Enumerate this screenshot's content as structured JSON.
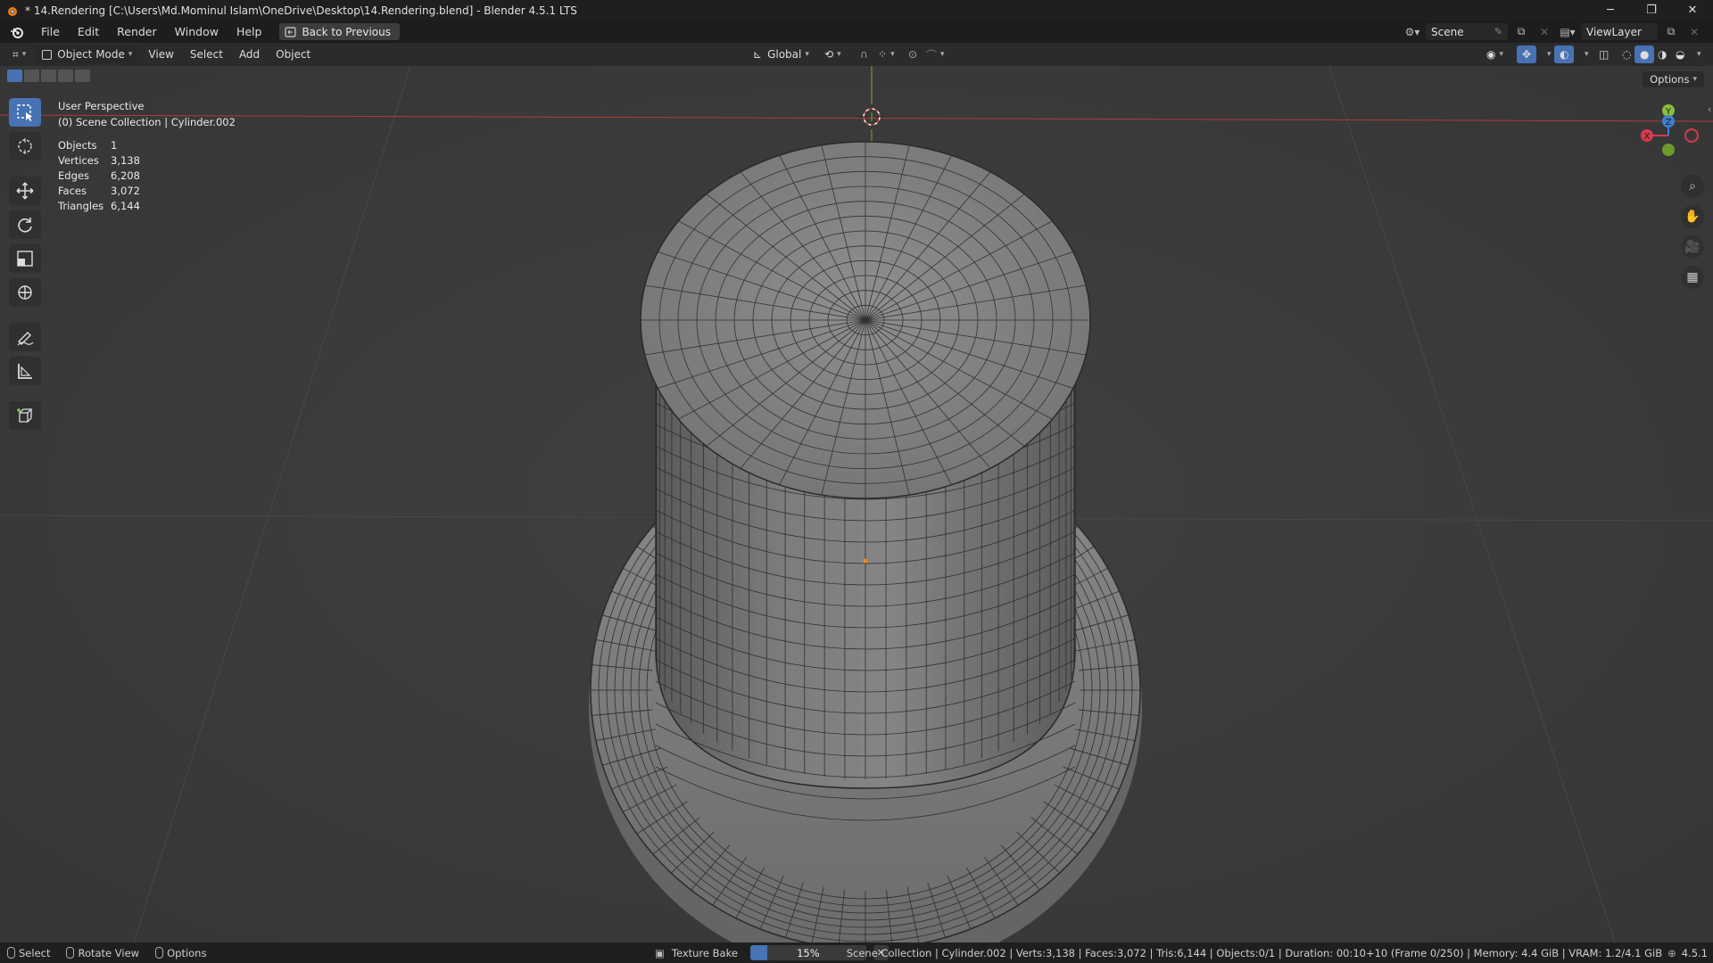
{
  "window": {
    "title": "* 14.Rendering [C:\\Users\\Md.Mominul Islam\\OneDrive\\Desktop\\14.Rendering.blend] - Blender 4.5.1 LTS",
    "controls": {
      "minimize": "─",
      "maximize": "❐",
      "close": "✕"
    }
  },
  "menu": {
    "items": [
      "File",
      "Edit",
      "Render",
      "Window",
      "Help"
    ],
    "back_button": "Back to Previous",
    "scene": "Scene",
    "view_layer": "ViewLayer"
  },
  "viewport_header": {
    "mode": "Object Mode",
    "menus": [
      "View",
      "Select",
      "Add",
      "Object"
    ],
    "transform_orientation": "Global"
  },
  "viewport": {
    "perspective": "User Perspective",
    "collection": "(0) Scene Collection | Cylinder.002",
    "options_label": "Options",
    "stats": [
      {
        "label": "Objects",
        "value": "1"
      },
      {
        "label": "Vertices",
        "value": "3,138"
      },
      {
        "label": "Edges",
        "value": "6,208"
      },
      {
        "label": "Faces",
        "value": "3,072"
      },
      {
        "label": "Triangles",
        "value": "6,144"
      }
    ],
    "gizmo": {
      "x": "X",
      "y": "Y",
      "z": "Z"
    }
  },
  "statusbar": {
    "hints": [
      "Select",
      "Rotate View",
      "Options"
    ],
    "job_label": "Texture Bake",
    "progress_percent": 15,
    "progress_text": "15%",
    "info": "Scene Collection | Cylinder.002 | Verts:3,138 | Faces:3,072 | Tris:6,144 | Objects:0/1 | Duration: 00:10+10 (Frame 0/250) | Memory: 4.4 GiB | VRAM: 1.2/4.1 GiB",
    "version": "4.5.1"
  },
  "colors": {
    "accent": "#4772b3",
    "x_axis": "#d9394f",
    "y_axis": "#8bbf3b",
    "z_axis": "#3e80d0"
  }
}
